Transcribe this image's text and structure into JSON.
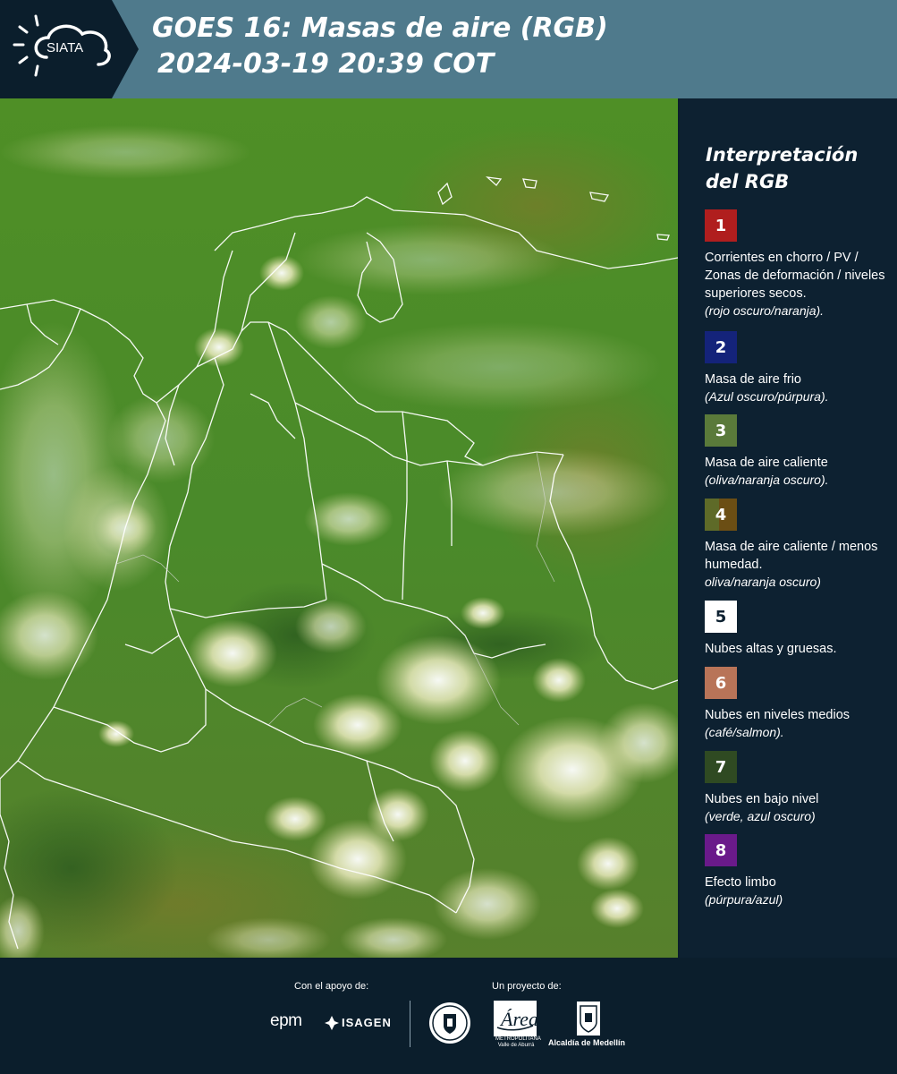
{
  "header": {
    "logo_text": "SIATA",
    "title_line1": "GOES 16: Masas de aire (RGB)",
    "title_line2": "2024-03-19 20:39 COT"
  },
  "legend": {
    "title": "Interpretación del RGB",
    "items": [
      {
        "number": "1",
        "color": "#b01e1e",
        "description": "Corrientes en chorro / PV / Zonas de deformación / niveles superiores secos.",
        "note": "(rojo oscuro/naranja)."
      },
      {
        "number": "2",
        "color": "#14237a",
        "description": "Masa de aire frio",
        "note": "(Azul oscuro/púrpura)."
      },
      {
        "number": "3",
        "color": "#5a7a3a",
        "description": "Masa de aire caliente",
        "note": "(oliva/naranja oscuro)."
      },
      {
        "number": "4",
        "color": "#6b5418",
        "description": "Masa de aire caliente / menos humedad.",
        "note": "oliva/naranja oscuro)"
      },
      {
        "number": "5",
        "color": "#ffffff",
        "description": "Nubes altas y gruesas.",
        "note": ""
      },
      {
        "number": "6",
        "color": "#b87458",
        "description": "Nubes en niveles medios",
        "note": "(café/salmon)."
      },
      {
        "number": "7",
        "color": "#2f4a22",
        "description": "Nubes en bajo nivel",
        "note": "(verde, azul oscuro)"
      },
      {
        "number": "8",
        "color": "#6a1a8a",
        "description": "Efecto limbo",
        "note": "(púrpura/azul)"
      }
    ]
  },
  "footer": {
    "support_label": "Con el apoyo de:",
    "project_label": "Un proyecto de:",
    "epm": "epm",
    "isagen": "ISAGEN",
    "amva_logo": "Área",
    "amva": "METROPOLITANA Valle de Aburrá",
    "medellin": "Alcaldía de Medellín"
  }
}
